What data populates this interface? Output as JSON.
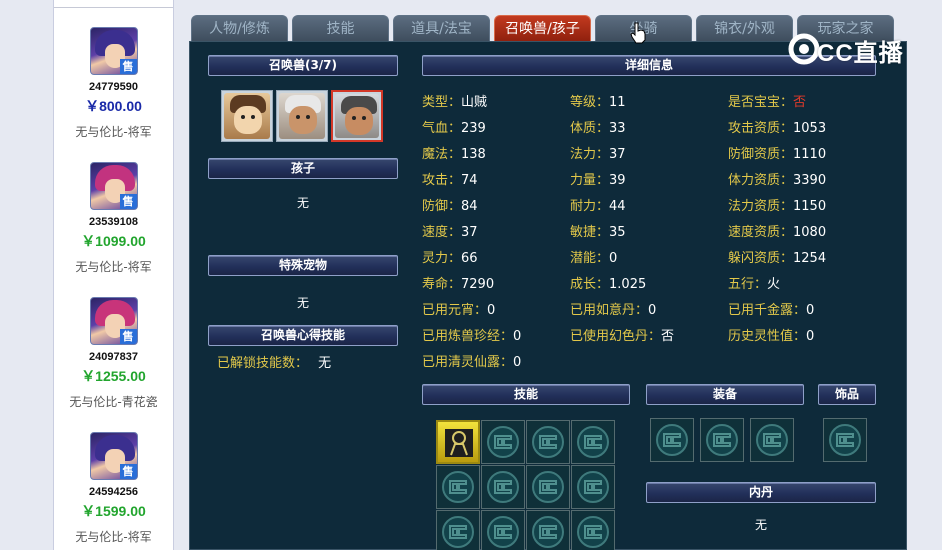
{
  "listings": [
    {
      "id": "24779590",
      "price": "￥800.00",
      "price_color": "#1a2aa8",
      "server": "无与伦比-将军",
      "sale_tag": "售"
    },
    {
      "id": "23539108",
      "price": "￥1099.00",
      "price_color": "#22a52e",
      "server": "无与伦比-将军",
      "sale_tag": "售"
    },
    {
      "id": "24097837",
      "price": "￥1255.00",
      "price_color": "#22a52e",
      "server": "无与伦比-青花瓷",
      "sale_tag": "售"
    },
    {
      "id": "24594256",
      "price": "￥1599.00",
      "price_color": "#22a52e",
      "server": "无与伦比-将军",
      "sale_tag": "售"
    }
  ],
  "tabs": [
    "人物/修炼",
    "技能",
    "道具/法宝",
    "召唤兽/孩子",
    "坐骑",
    "锦衣/外观",
    "玩家之家"
  ],
  "active_tab": "召唤兽/孩子",
  "left_panel": {
    "summon_title": "召唤兽(3/7)",
    "child_title": "孩子",
    "child_value": "无",
    "special_title": "特殊宠物",
    "special_value": "无",
    "skill_insight_title": "召唤兽心得技能",
    "unlocked_label": "已解锁技能数：",
    "unlocked_value": "无"
  },
  "detail_title": "详细信息",
  "attributes": {
    "col1": [
      {
        "k": "类型：",
        "v": "山贼"
      },
      {
        "k": "气血：",
        "v": "239"
      },
      {
        "k": "魔法：",
        "v": "138"
      },
      {
        "k": "攻击：",
        "v": "74"
      },
      {
        "k": "防御：",
        "v": "84"
      },
      {
        "k": "速度：",
        "v": "37"
      },
      {
        "k": "灵力：",
        "v": "66"
      },
      {
        "k": "寿命：",
        "v": "7290"
      },
      {
        "k": "已用元宵：",
        "v": "0"
      },
      {
        "k": "已用炼兽珍经：",
        "v": "0"
      },
      {
        "k": "已用清灵仙露：",
        "v": "0"
      }
    ],
    "col2": [
      {
        "k": "等级：",
        "v": "11"
      },
      {
        "k": "体质：",
        "v": "33"
      },
      {
        "k": "法力：",
        "v": "37"
      },
      {
        "k": "力量：",
        "v": "39"
      },
      {
        "k": "耐力：",
        "v": "44"
      },
      {
        "k": "敏捷：",
        "v": "35"
      },
      {
        "k": "潜能：",
        "v": "0"
      },
      {
        "k": "成长：",
        "v": "1.025"
      },
      {
        "k": "已用如意丹：",
        "v": "0"
      },
      {
        "k": "已使用幻色丹：",
        "v": "否"
      }
    ],
    "col3": [
      {
        "k": "是否宝宝：",
        "v": "否"
      },
      {
        "k": "攻击资质：",
        "v": "1053"
      },
      {
        "k": "防御资质：",
        "v": "1110"
      },
      {
        "k": "体力资质：",
        "v": "3390"
      },
      {
        "k": "法力资质：",
        "v": "1150"
      },
      {
        "k": "速度资质：",
        "v": "1080"
      },
      {
        "k": "躲闪资质：",
        "v": "1254"
      },
      {
        "k": "五行：",
        "v": "火"
      },
      {
        "k": "已用千金露：",
        "v": "0"
      },
      {
        "k": "历史灵性值：",
        "v": "0"
      }
    ]
  },
  "skills_title": "技能",
  "equip_title": "装备",
  "ornament_title": "饰品",
  "neidan_title": "内丹",
  "neidan_value": "无",
  "watermark_text": "CC直播",
  "colors": {
    "panel_bg": "#0e2a3a",
    "key_text": "#e2c84a",
    "active_tab": "#b52c15"
  }
}
